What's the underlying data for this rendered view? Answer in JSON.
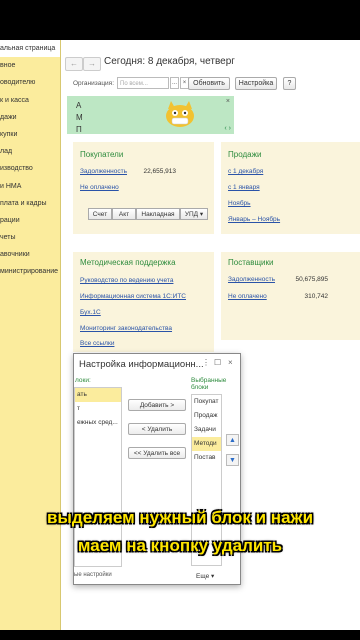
{
  "sidebar": {
    "items": [
      {
        "label": "альная страница",
        "active": true
      },
      {
        "label": "вное"
      },
      {
        "label": "оводителю"
      },
      {
        "label": "к и касса"
      },
      {
        "label": "дажи"
      },
      {
        "label": "купки"
      },
      {
        "label": "лад"
      },
      {
        "label": "изводство"
      },
      {
        "label": "и НМА"
      },
      {
        "label": "плата и кадры"
      },
      {
        "label": "рации"
      },
      {
        "label": "четы"
      },
      {
        "label": "авочники"
      },
      {
        "label": "министрирование"
      }
    ]
  },
  "toolbar": {
    "back": "←",
    "forward": "→",
    "title": "Сегодня: 8 декабря, четверг",
    "org_label": "Организация:",
    "org_placeholder": "По всем...",
    "dots": "...",
    "clear": "×",
    "refresh": "Обновить",
    "settings": "Настройка",
    "help": "?"
  },
  "banner": {
    "line1": "А",
    "line2": "М",
    "line3": "П",
    "close": "×",
    "arrows": "‹ ›"
  },
  "buyers": {
    "title": "Покупатели",
    "debt_label": "Задолженность",
    "debt_value": "22,655,913",
    "unpaid_label": "Не оплачено",
    "buttons": [
      "Счет",
      "Акт",
      "Накладная",
      "УПД ▾"
    ]
  },
  "sales": {
    "title": "Продажи",
    "links": [
      "с 1 декабря",
      "с 1 января",
      "Ноябрь",
      "Январь – Ноябрь"
    ]
  },
  "support": {
    "title": "Методическая поддержка",
    "links": [
      "Руководство по ведению учета",
      "Информационная система 1С:ИТС",
      "Бух.1С",
      "Мониторинг законодательства",
      "Все ссылки"
    ]
  },
  "suppliers": {
    "title": "Поставщики",
    "debt_label": "Задолженность",
    "debt_value": "50,675,895",
    "unpaid_label": "Не оплачено",
    "unpaid_value": "310,742"
  },
  "dialog": {
    "title": "Настройка информационн...",
    "menu": "⋮",
    "maximize": "☐",
    "close": "×",
    "left_header": "локи:",
    "left_items": [
      "ать",
      "т",
      "ежных сред..."
    ],
    "add": "Добавить >",
    "remove": "< Удалить",
    "remove_all": "<< Удалить все",
    "right_header": "Выбранные блоки",
    "right_items": [
      "Покупат",
      "Продаж",
      "Задачи",
      "Методи",
      "Постав"
    ],
    "selected_index": 3,
    "up": "▲",
    "down": "▼",
    "bottom_left": "ые настройки",
    "more": "Еще ▾"
  },
  "caption": {
    "line1": "выделяем нужный блок и нажи",
    "line2": "маем на кнопку удалить"
  },
  "colors": {
    "sidebar": "#fbec9d",
    "panel": "#faf4dc",
    "link": "#2a53a8",
    "title_green": "#2d8b3d",
    "caption": "#ffe600"
  }
}
